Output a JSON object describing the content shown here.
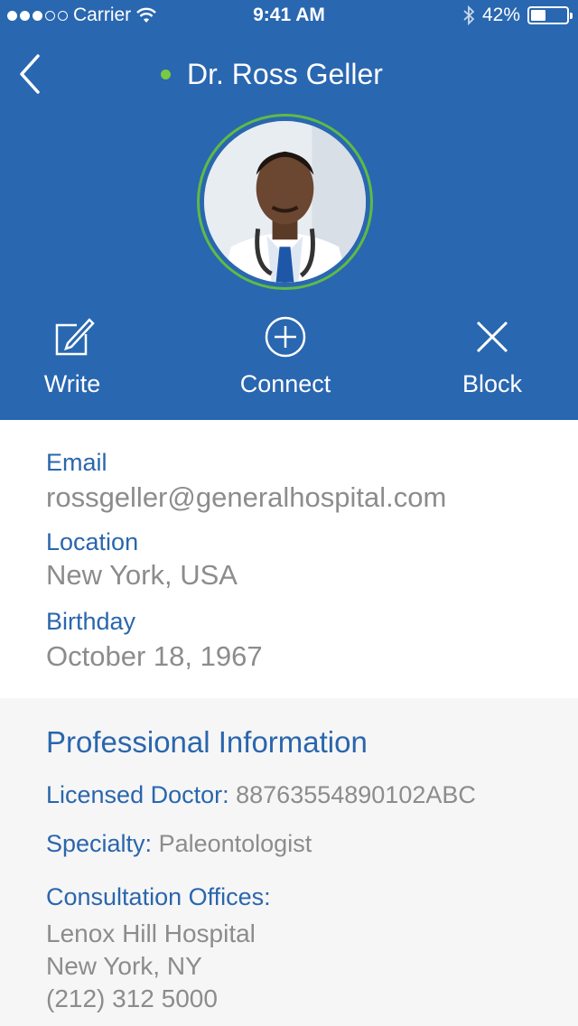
{
  "status_bar": {
    "carrier": "Carrier",
    "time": "9:41 AM",
    "battery": "42%",
    "battery_level": 0.42
  },
  "header": {
    "name": "Dr. Ross Geller",
    "online_color": "#7ac943"
  },
  "actions": [
    {
      "label": "Write",
      "icon": "edit-icon"
    },
    {
      "label": "Connect",
      "icon": "plus-circle-icon"
    },
    {
      "label": "Block",
      "icon": "close-icon"
    }
  ],
  "contact": {
    "email_label": "Email",
    "email": "rossgeller@generalhospital.com",
    "location_label": "Location",
    "location": "New York, USA",
    "birthday_label": "Birthday",
    "birthday": "October 18, 1967"
  },
  "professional": {
    "title": "Professional Information",
    "license_label": "Licensed Doctor:",
    "license": "88763554890102ABC",
    "specialty_label": "Specialty:",
    "specialty": "Paleontologist",
    "offices_label": "Consultation Offices:",
    "office_name": "Lenox Hill Hospital",
    "office_city": "New York, NY",
    "office_phone": "(212) 312 5000"
  },
  "colors": {
    "header_bg": "#2967b0",
    "accent": "#2a66ad",
    "muted": "#8c8c8c",
    "avatar_ring": "#5fba46"
  }
}
